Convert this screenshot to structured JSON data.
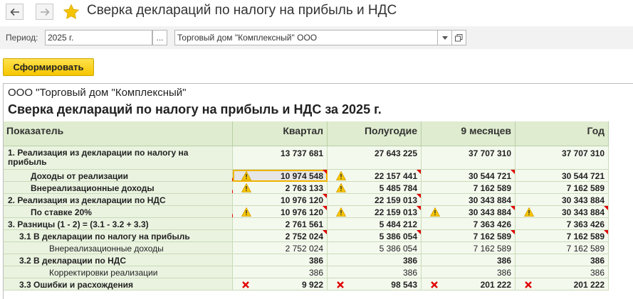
{
  "window": {
    "title": "Сверка деклараций по налогу на прибыль и НДС"
  },
  "params": {
    "period_label": "Период:",
    "period_value": "2025 г.",
    "period_btn": "...",
    "org_value": "Торговый дом \"Комплексный\" ООО"
  },
  "toolbar": {
    "generate_label": "Сформировать"
  },
  "report": {
    "org": "ООО \"Торговый дом \"Комплексный\"",
    "title": "Сверка деклараций по налогу на прибыль и НДС за 2025 г.",
    "columns": [
      "Показатель",
      "Квартал",
      "Полугодие",
      "9 месяцев",
      "Год"
    ],
    "rows": [
      {
        "label": "1. Реализация из декларации по налогу на",
        "label2": "прибыль",
        "values": [
          "13 737 681",
          "27 643 225",
          "37 707 310",
          "37 707 310"
        ]
      },
      {
        "label": "Доходы от реализации",
        "values": [
          "10 974 548",
          "22 157 441",
          "30 544 721",
          "30 544 721"
        ]
      },
      {
        "label": "Внереализационные доходы",
        "values": [
          "2 763 133",
          "5 485 784",
          "7 162 589",
          "7 162 589"
        ]
      },
      {
        "label": "2. Реализация из декларации по НДС",
        "values": [
          "10 976 120",
          "22 159 013",
          "30 343 884",
          "30 343 884"
        ]
      },
      {
        "label": "По ставке 20%",
        "values": [
          "10 976 120",
          "22 159 013",
          "30 343 884",
          "30 343 884"
        ]
      },
      {
        "label": "3. Разницы (1 - 2) = (3.1 - 3.2 + 3.3)",
        "values": [
          "2 761 561",
          "5 484 212",
          "7 363 426",
          "7 363 426"
        ]
      },
      {
        "label": "3.1 В декларации по налогу на прибыль",
        "values": [
          "2 752 024",
          "5 386 054",
          "7 162 589",
          "7 162 589"
        ]
      },
      {
        "label": "Внереализационные доходы",
        "values": [
          "2 752 024",
          "5 386 054",
          "7 162 589",
          "7 162 589"
        ]
      },
      {
        "label": "3.2 В декларации по НДС",
        "values": [
          "386",
          "386",
          "386",
          "386"
        ]
      },
      {
        "label": "Корректировки реализации",
        "values": [
          "386",
          "386",
          "386",
          "386"
        ]
      },
      {
        "label": "3.3 Ошибки и расхождения",
        "values": [
          "9 922",
          "98 543",
          "201 222",
          "201 222"
        ]
      }
    ]
  },
  "icons": {
    "warning": "warning-icon",
    "error": "error-x-icon",
    "star": "favorite-star-icon"
  },
  "colors": {
    "header_bg": "#dfeccf",
    "label_bg": "#eaf3e0",
    "generate_btn": "#f7c600",
    "flag_red": "#e00000",
    "star": "#f5c400"
  }
}
